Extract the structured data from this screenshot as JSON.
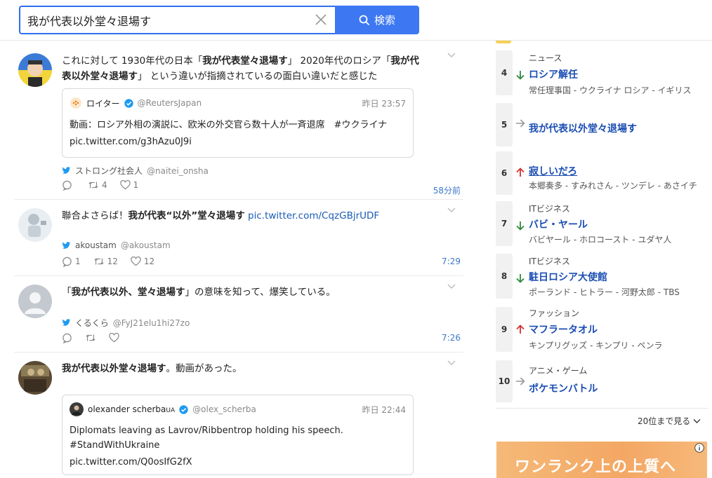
{
  "search": {
    "value": "我が代表以外堂々退場す",
    "button_label": "検索"
  },
  "tweets": [
    {
      "text_pre": "これに対して 1930年代の日本「",
      "bold1": "我が代表堂々退場す",
      "text_mid": "」 2020年代のロシア「",
      "bold2": "我が代表以外堂々退場す",
      "text_post": "」 という違いが指摘されているの面白い違いだと感じた",
      "quote": {
        "name": "ロイター",
        "handle": "@ReutersJapan",
        "time": "昨日 23:57",
        "body": "動画：ロシア外相の演説に、欧米の外交官ら数十人が一斉退席　#ウクライナ",
        "link": "pic.twitter.com/g3hAzu0J9i"
      },
      "author": "ストロング社会人",
      "handle": "@naitei_onsha",
      "retweets": "4",
      "likes": "1",
      "replies": "",
      "time": "58分前"
    },
    {
      "text_pre": "聯合よさらば！",
      "bold1": "我が代表“以外”堂々退場す",
      "link": "pic.twitter.com/CqzGBjrUDF",
      "author": "akoustam",
      "handle": "@akoustam",
      "replies": "1",
      "retweets": "12",
      "likes": "12",
      "time": "7:29"
    },
    {
      "text_pre": "「",
      "bold1": "我が代表以外、堂々退場す",
      "text_post": "」の意味を知って、爆笑している。",
      "author": "くるくら",
      "handle": "@FyJ21elu1hi27zo",
      "time": "7:26"
    },
    {
      "bold1": "我が代表以外堂々退場す",
      "text_post": "。動画があった。",
      "quote": {
        "name": "olexander scherba",
        "name_suffix": "UA",
        "handle": "@olex_scherba",
        "time": "昨日 22:44",
        "body1": "Diplomats leaving as Lavrov/Ribbentrop holding his speech.",
        "body2": "#StandWithUkraine",
        "link": "pic.twitter.com/Q0osIfG2fX"
      }
    }
  ],
  "trends": [
    {
      "rank": "4",
      "dir": "down",
      "category": "ニュース",
      "name": "ロシア解任",
      "related": "常任理事国 - ウクライナ ロシア - イギリス"
    },
    {
      "rank": "5",
      "dir": "flat",
      "category": "",
      "name": "我が代表以外堂々退場す",
      "related": ""
    },
    {
      "rank": "6",
      "dir": "up",
      "category": "",
      "name": "寂しいだろ",
      "related": "本郷奏多 - すみれさん - ツンデレ - あさイチ"
    },
    {
      "rank": "7",
      "dir": "down",
      "category": "ITビジネス",
      "name": "バビ・ヤール",
      "related": "バビヤール - ホロコースト - ユダヤ人"
    },
    {
      "rank": "8",
      "dir": "down",
      "category": "ITビジネス",
      "name": "駐日ロシア大使館",
      "related": "ポーランド - ヒトラー - 河野太郎 - TBS"
    },
    {
      "rank": "9",
      "dir": "up",
      "category": "ファッション",
      "name": "マフラータオル",
      "related": "キンプリグッズ - キンプリ - ペンラ"
    },
    {
      "rank": "10",
      "dir": "flat",
      "category": "アニメ・ゲーム",
      "name": "ポケモンバトル",
      "related": ""
    }
  ],
  "more_label": "20位まで見る",
  "ad_text": "ワンランク上の上質へ",
  "colors": {
    "accent": "#3d78f2",
    "link": "#1a4db3",
    "up": "#d0302f",
    "down": "#2e8a3e",
    "flat": "#888888"
  },
  "icons": [
    "search-icon",
    "clear-icon",
    "chevron-down-icon",
    "twitter-bird-icon",
    "verified-icon",
    "reply-icon",
    "retweet-icon",
    "like-icon",
    "arrow-up-icon",
    "arrow-down-icon",
    "arrow-right-icon",
    "info-icon"
  ]
}
